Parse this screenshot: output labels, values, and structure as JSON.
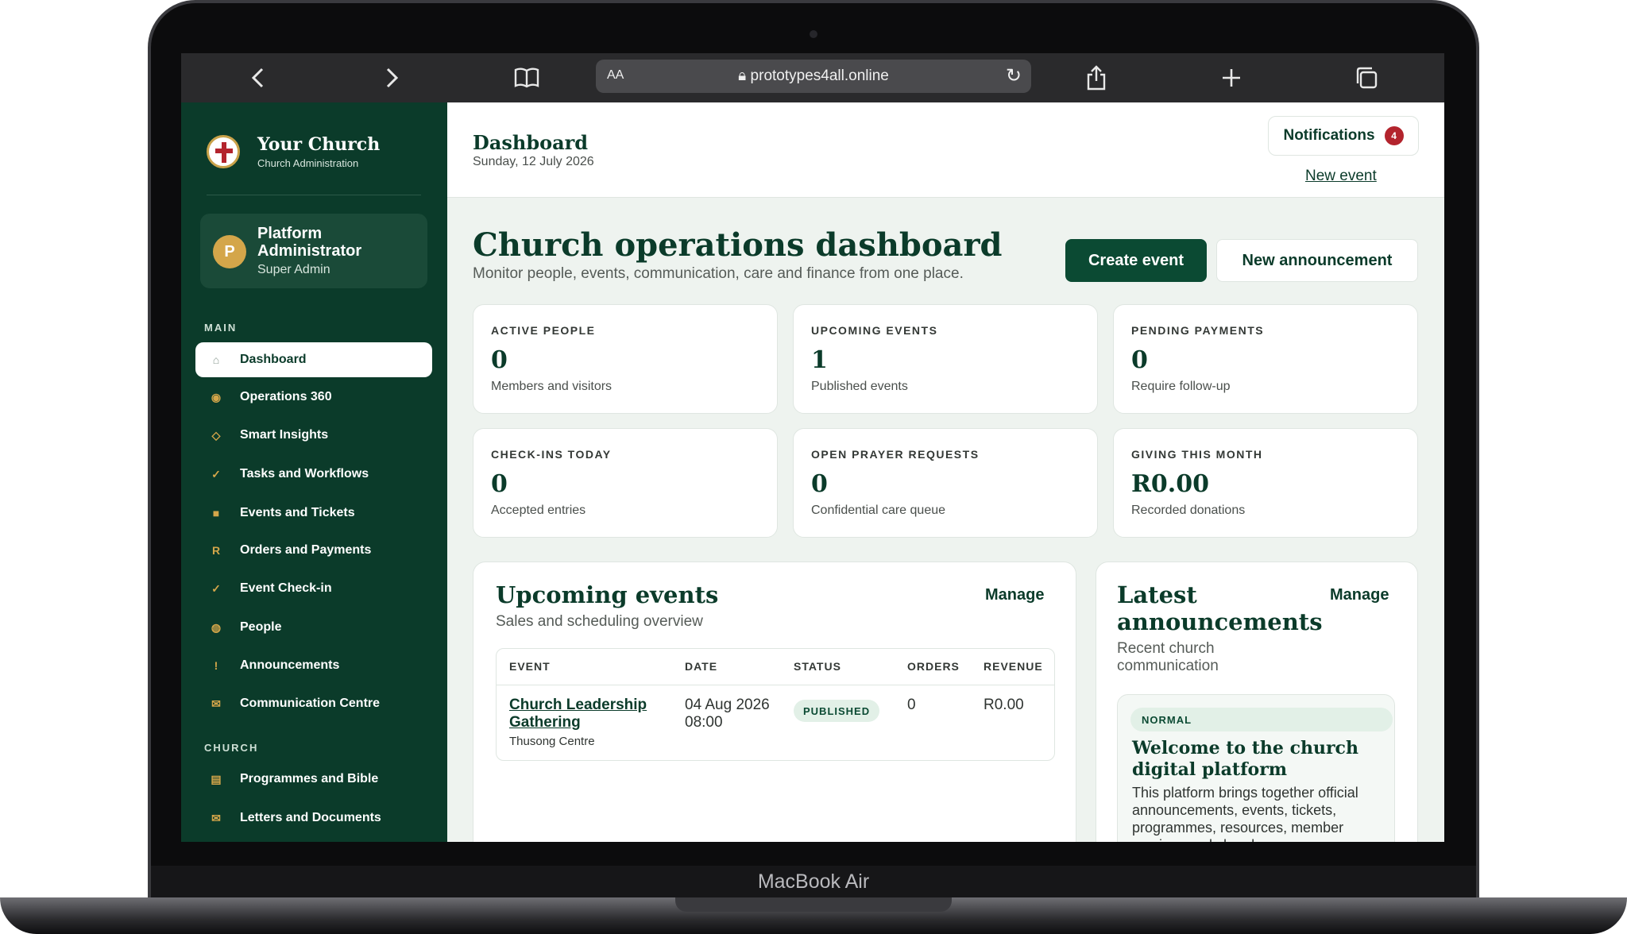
{
  "device": {
    "label": "MacBook Air"
  },
  "browser": {
    "url_host": "prototypes4all.online",
    "text_size_label": "AA",
    "icons": [
      "back-icon",
      "forward-icon",
      "reader-icon",
      "lock-icon",
      "reload-icon",
      "share-icon",
      "new-tab-icon",
      "tabs-icon"
    ]
  },
  "sidebar": {
    "brand_name": "Your Church",
    "brand_sub": "Church Administration",
    "user": {
      "initial": "P",
      "name": "Platform Administrator",
      "role": "Super Admin"
    },
    "sections": [
      {
        "title": "MAIN",
        "items": [
          {
            "label": "Dashboard",
            "icon": "⌂",
            "active": true
          },
          {
            "label": "Operations 360",
            "icon": "◉"
          },
          {
            "label": "Smart Insights",
            "icon": "◇"
          },
          {
            "label": "Tasks and Workflows",
            "icon": "✓"
          },
          {
            "label": "Events and Tickets",
            "icon": "■"
          },
          {
            "label": "Orders and Payments",
            "icon": "R"
          },
          {
            "label": "Event Check-in",
            "icon": "✓"
          },
          {
            "label": "People",
            "icon": "◍"
          },
          {
            "label": "Announcements",
            "icon": "!"
          },
          {
            "label": "Communication Centre",
            "icon": "✉"
          }
        ]
      },
      {
        "title": "CHURCH",
        "items": [
          {
            "label": "Programmes and Bible",
            "icon": "▤"
          },
          {
            "label": "Letters and Documents",
            "icon": "✉"
          }
        ]
      }
    ]
  },
  "topbar": {
    "title": "Dashboard",
    "date": "Sunday, 12 July 2026",
    "notifications_label": "Notifications",
    "notifications_count": "4",
    "new_event_link": "New event"
  },
  "hero": {
    "title": "Church operations dashboard",
    "subtitle": "Monitor people, events, communication, care and finance from one place.",
    "primary_button": "Create event",
    "secondary_button": "New announcement"
  },
  "stats": [
    {
      "label": "ACTIVE PEOPLE",
      "value": "0",
      "caption": "Members and visitors"
    },
    {
      "label": "UPCOMING EVENTS",
      "value": "1",
      "caption": "Published events"
    },
    {
      "label": "PENDING PAYMENTS",
      "value": "0",
      "caption": "Require follow-up"
    },
    {
      "label": "CHECK-INS TODAY",
      "value": "0",
      "caption": "Accepted entries"
    },
    {
      "label": "OPEN PRAYER REQUESTS",
      "value": "0",
      "caption": "Confidential care queue"
    },
    {
      "label": "GIVING THIS MONTH",
      "value": "R0.00",
      "caption": "Recorded donations"
    }
  ],
  "upcoming": {
    "title": "Upcoming events",
    "subtitle": "Sales and scheduling overview",
    "manage_label": "Manage",
    "columns": [
      "EVENT",
      "DATE",
      "STATUS",
      "ORDERS",
      "REVENUE"
    ],
    "rows": [
      {
        "event": "Church Leadership Gathering",
        "venue": "Thusong Centre",
        "date": "04 Aug 2026 08:00",
        "status": "PUBLISHED",
        "orders": "0",
        "revenue": "R0.00"
      }
    ]
  },
  "announcements": {
    "title": "Latest announcements",
    "subtitle": "Recent church communication",
    "manage_label": "Manage",
    "items": [
      {
        "priority": "NORMAL",
        "title": "Welcome to the church digital platform",
        "body": "This platform brings together official announcements, events, tickets, programmes, resources, member services and church"
      }
    ]
  }
}
